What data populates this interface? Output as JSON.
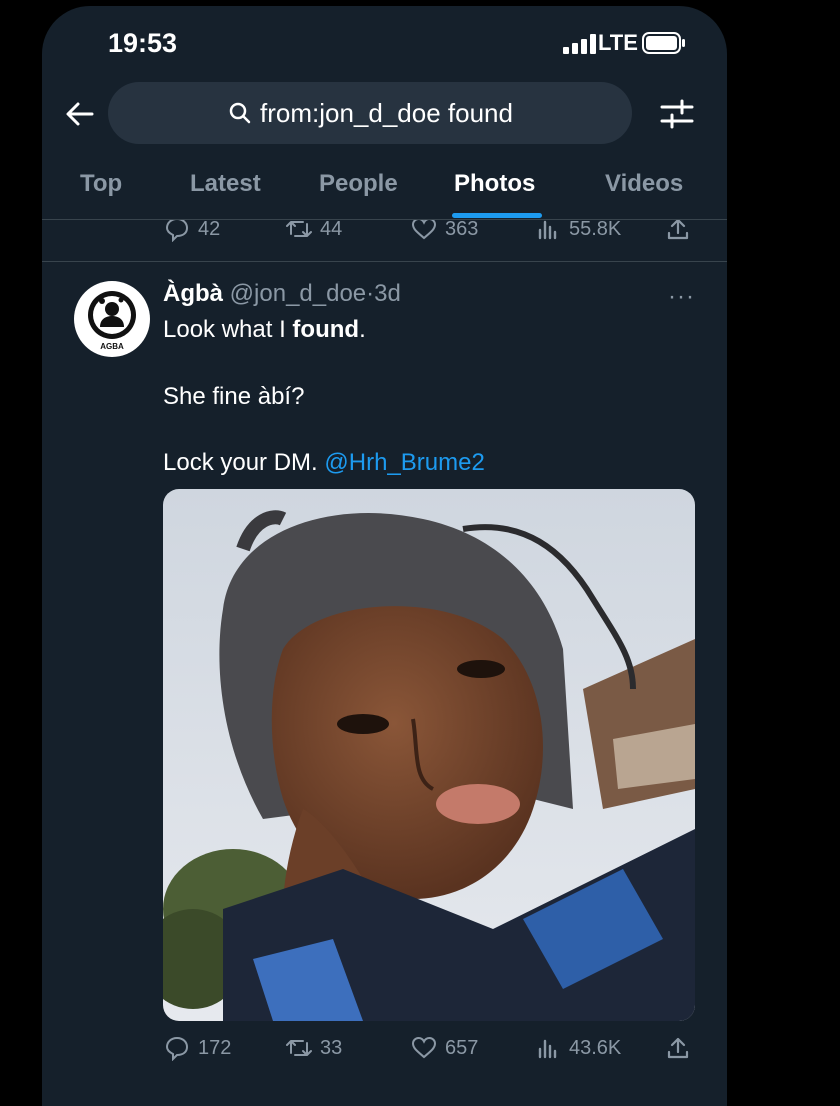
{
  "status_bar": {
    "time": "19:53",
    "network": "LTE"
  },
  "search": {
    "query": "from:jon_d_doe found"
  },
  "tabs": [
    {
      "label": "Top"
    },
    {
      "label": "Latest"
    },
    {
      "label": "People"
    },
    {
      "label": "Photos"
    },
    {
      "label": "Videos"
    }
  ],
  "active_tab": "Photos",
  "prev_tweet": {
    "replies": "42",
    "retweets": "44",
    "likes": "363",
    "views": "55.8K"
  },
  "tweet": {
    "avatar_text": "AGBA",
    "author_name": "Àgbà",
    "handle": "@jon_d_doe",
    "dot": "·",
    "time_ago": "3d",
    "more": "···",
    "line1_pre": "Look what I ",
    "line1_bold": "found",
    "line1_post": ".",
    "line2": "She fine àbí?",
    "line3_pre": "Lock your DM. ",
    "mention": "@Hrh_Brume2",
    "replies": "172",
    "retweets": "33",
    "likes": "657",
    "views": "43.6K"
  },
  "colors": {
    "background": "#15202b",
    "accent": "#1d9bf0",
    "muted": "#8b98a5"
  }
}
